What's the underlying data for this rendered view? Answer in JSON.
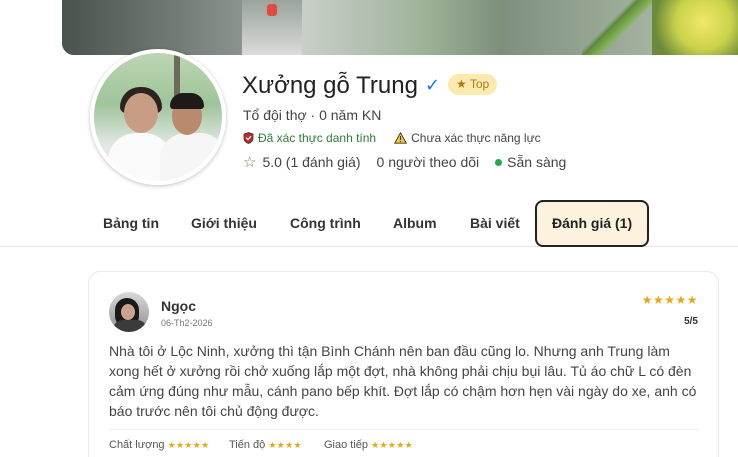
{
  "profile": {
    "name": "Xưởng gỗ Trung",
    "verified_icon": "check-mark-icon",
    "top_badge": "★ Top",
    "subtitle": "Tổ đội thợ · 0 năm KN",
    "identity_verified": "Đã xác thực danh tính",
    "capability_unverified": "Chưa xác thực năng lực",
    "rating": "5.0 (1 đánh giá)",
    "followers": "0 người theo dõi",
    "status": "Sẵn sàng",
    "status_color": "#28a745"
  },
  "tabs": [
    {
      "label": "Bảng tin"
    },
    {
      "label": "Giới thiệu"
    },
    {
      "label": "Công trình"
    },
    {
      "label": "Album"
    },
    {
      "label": "Bài viết"
    },
    {
      "label": "Đánh giá (1)",
      "active": true
    }
  ],
  "review": {
    "author": "Ngọc",
    "date": "06-Th2-2026",
    "stars": "★★★★★",
    "score": "5/5",
    "text": "Nhà tôi ở Lộc Ninh, xưởng thì tận Bình Chánh nên ban đầu cũng lo. Nhưng anh Trung làm xong hết ở xưởng rồi chở xuống lắp một đợt, nhà không phải chịu bụi lâu. Tủ áo chữ L có đèn cảm ứng đúng như mẫu, cánh pano bếp khít. Đợt lắp có chậm hơn hẹn vài ngày do xe, anh có báo trước nên tôi chủ động được.",
    "criteria": [
      {
        "label": "Chất lượng",
        "stars": "★★★★★"
      },
      {
        "label": "Tiến độ",
        "stars": "★★★★"
      },
      {
        "label": "Giao tiếp",
        "stars": "★★★★★"
      }
    ]
  },
  "colors": {
    "accent_tab_bg": "#fcf2dd",
    "star": "#e6a817",
    "verified_blue": "#1a73e8",
    "verified_green": "#2e7d32"
  }
}
